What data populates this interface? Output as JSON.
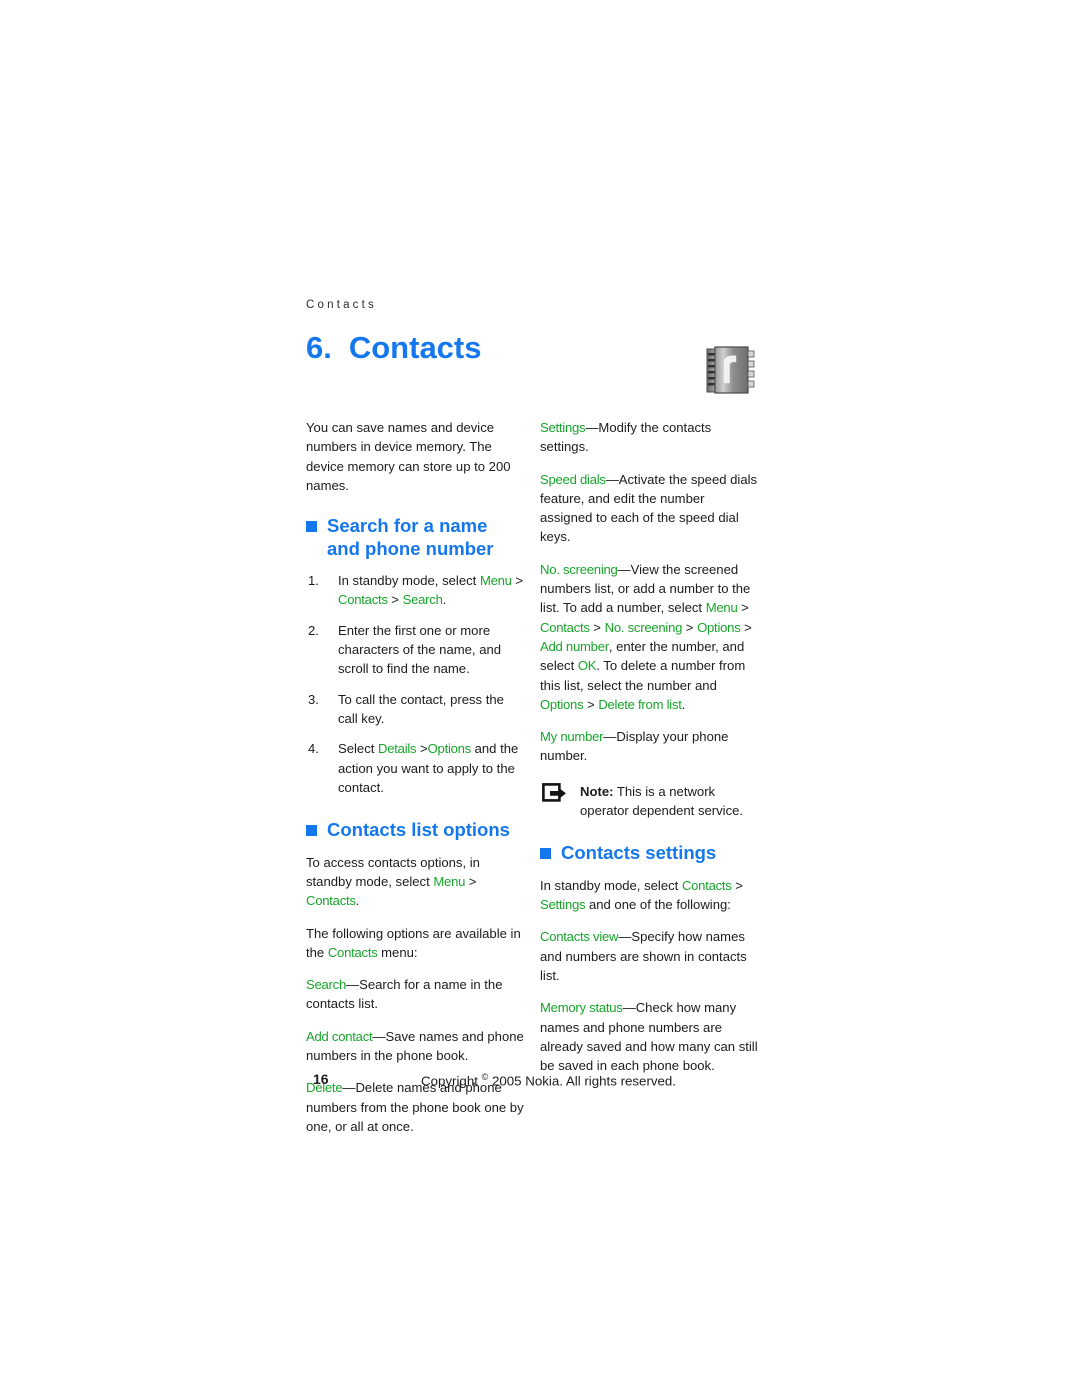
{
  "page": {
    "running_header": "Contacts",
    "chapter_number": "6.",
    "chapter_title": "Contacts",
    "chapter_icon": "address-book-icon",
    "page_number": "16",
    "copyright": "Copyright © 2005 Nokia. All rights reserved.",
    "copyright_prefix": "Copyright",
    "copyright_symbol": "©",
    "copyright_rest": "2005 Nokia. All rights reserved."
  },
  "colors": {
    "heading_blue": "#1577ee",
    "ui_term_green": "#18a52b",
    "body_text": "#1c1c1c"
  },
  "left_column": {
    "intro": "You can save names and device numbers in device memory. The device memory can store up to 200 names.",
    "heading_search": "Search for a name and phone number",
    "steps": [
      {
        "num": "1.",
        "parts": [
          {
            "t": "In standby mode, select ",
            "ui": false
          },
          {
            "t": "Menu",
            "ui": true
          },
          {
            "t": " > ",
            "ui": false
          },
          {
            "t": "Contacts",
            "ui": true
          },
          {
            "t": " > ",
            "ui": false
          },
          {
            "t": "Search",
            "ui": true
          },
          {
            "t": ".",
            "ui": false
          }
        ]
      },
      {
        "num": "2.",
        "parts": [
          {
            "t": "Enter the first one or more characters of the name, and scroll to find the name.",
            "ui": false
          }
        ]
      },
      {
        "num": "3.",
        "parts": [
          {
            "t": "To call the contact, press the call key.",
            "ui": false
          }
        ]
      },
      {
        "num": "4.",
        "parts": [
          {
            "t": "Select ",
            "ui": false
          },
          {
            "t": "Details",
            "ui": true
          },
          {
            "t": " >",
            "ui": false
          },
          {
            "t": "Options",
            "ui": true
          },
          {
            "t": " and the action you want to apply to the contact.",
            "ui": false
          }
        ]
      }
    ],
    "heading_list_options": "Contacts list options",
    "paragraphs": [
      [
        {
          "t": "To access contacts options, in standby mode, select ",
          "ui": false
        },
        {
          "t": "Menu",
          "ui": true
        },
        {
          "t": " > ",
          "ui": false
        },
        {
          "t": "Contacts",
          "ui": true
        },
        {
          "t": ".",
          "ui": false
        }
      ],
      [
        {
          "t": "The following options are available in the ",
          "ui": false
        },
        {
          "t": "Contacts",
          "ui": true
        },
        {
          "t": " menu:",
          "ui": false
        }
      ],
      [
        {
          "t": "Search",
          "ui": true
        },
        {
          "t": "—Search for a name in the contacts list.",
          "ui": false
        }
      ],
      [
        {
          "t": "Add contact",
          "ui": true
        },
        {
          "t": "—Save names and phone numbers in the phone book.",
          "ui": false
        }
      ],
      [
        {
          "t": "Delete",
          "ui": true
        },
        {
          "t": "—Delete names and phone numbers from the phone book one by one, or all at once.",
          "ui": false
        }
      ]
    ]
  },
  "right_column": {
    "paragraphs_top": [
      [
        {
          "t": "Settings",
          "ui": true
        },
        {
          "t": "—Modify the contacts settings.",
          "ui": false
        }
      ],
      [
        {
          "t": "Speed dials",
          "ui": true
        },
        {
          "t": "—Activate the speed dials feature, and edit the number assigned to each of the speed dial keys.",
          "ui": false
        }
      ],
      [
        {
          "t": "No. screening",
          "ui": true
        },
        {
          "t": "—View the screened numbers list, or add a number to the list. To add a number, select ",
          "ui": false
        },
        {
          "t": "Menu",
          "ui": true
        },
        {
          "t": " > ",
          "ui": false
        },
        {
          "t": "Contacts",
          "ui": true
        },
        {
          "t": " > ",
          "ui": false
        },
        {
          "t": "No. screening",
          "ui": true
        },
        {
          "t": " > ",
          "ui": false
        },
        {
          "t": "Options",
          "ui": true
        },
        {
          "t": " > ",
          "ui": false
        },
        {
          "t": "Add number",
          "ui": true
        },
        {
          "t": ", enter the number, and select ",
          "ui": false
        },
        {
          "t": "OK",
          "ui": true
        },
        {
          "t": ". To delete a number from this list, select the number and ",
          "ui": false
        },
        {
          "t": "Options",
          "ui": true
        },
        {
          "t": " > ",
          "ui": false
        },
        {
          "t": "Delete from list",
          "ui": true
        },
        {
          "t": ".",
          "ui": false
        }
      ],
      [
        {
          "t": "My number",
          "ui": true
        },
        {
          "t": "—Display your phone number.",
          "ui": false
        }
      ]
    ],
    "note": {
      "icon": "note-arrow-icon",
      "label": "Note:",
      "text": " This is a network operator dependent service."
    },
    "heading_settings": "Contacts settings",
    "paragraphs_bottom": [
      [
        {
          "t": "In standby mode, select ",
          "ui": false
        },
        {
          "t": "Contacts",
          "ui": true
        },
        {
          "t": " > ",
          "ui": false
        },
        {
          "t": "Settings",
          "ui": true
        },
        {
          "t": " and one of the following:",
          "ui": false
        }
      ],
      [
        {
          "t": "Contacts view",
          "ui": true
        },
        {
          "t": "—Specify how names and numbers are shown in contacts list.",
          "ui": false
        }
      ],
      [
        {
          "t": "Memory status",
          "ui": true
        },
        {
          "t": "—Check how many names and phone numbers are already saved and how many can still be saved in each phone book.",
          "ui": false
        }
      ]
    ]
  }
}
